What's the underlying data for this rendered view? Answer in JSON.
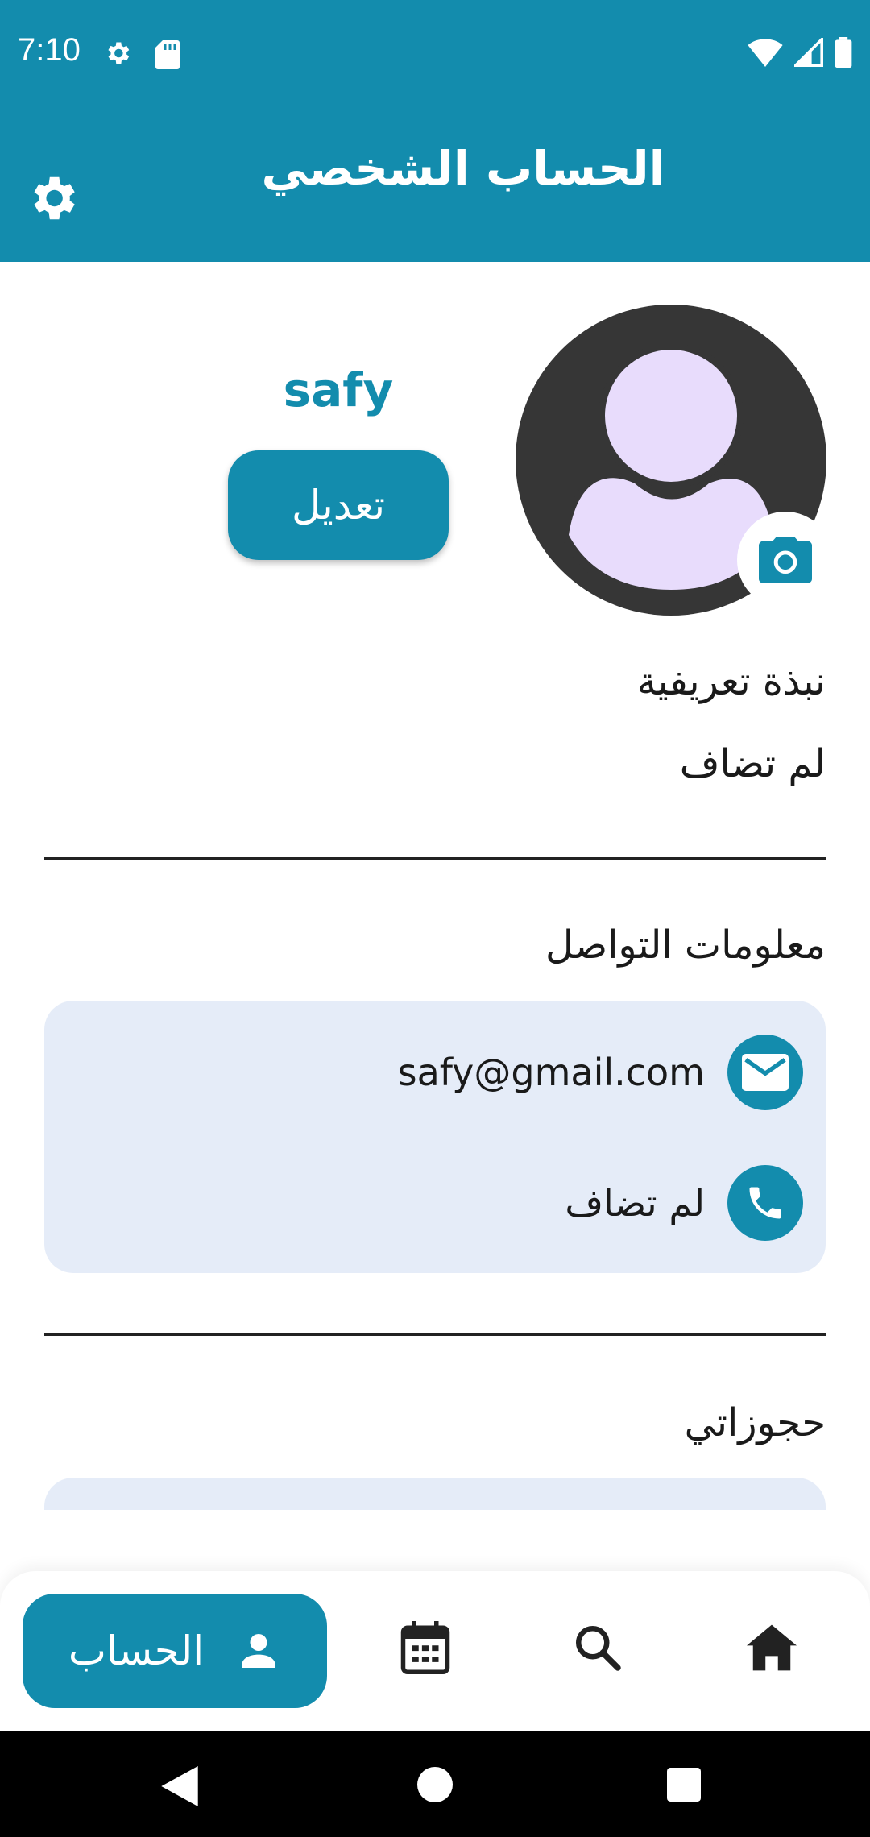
{
  "status_bar": {
    "time": "7:10"
  },
  "app_bar": {
    "title": "الحساب الشخصي"
  },
  "profile": {
    "username": "safy",
    "edit_label": "تعديل"
  },
  "bio": {
    "title": "نبذة تعريفية",
    "value": "لم تضاف"
  },
  "contact": {
    "title": "معلومات التواصل",
    "email": "safy@gmail.com",
    "phone": "لم تضاف"
  },
  "bookings": {
    "title": "حجوزاتي"
  },
  "bottom_nav": {
    "active_label": "الحساب",
    "items": [
      "account-icon",
      "calendar-icon",
      "search-icon",
      "home-icon"
    ]
  },
  "colors": {
    "primary": "#138cad",
    "card": "#e5ecf8",
    "avatar_bg": "#363636",
    "avatar_fg": "#e8dcfc"
  }
}
